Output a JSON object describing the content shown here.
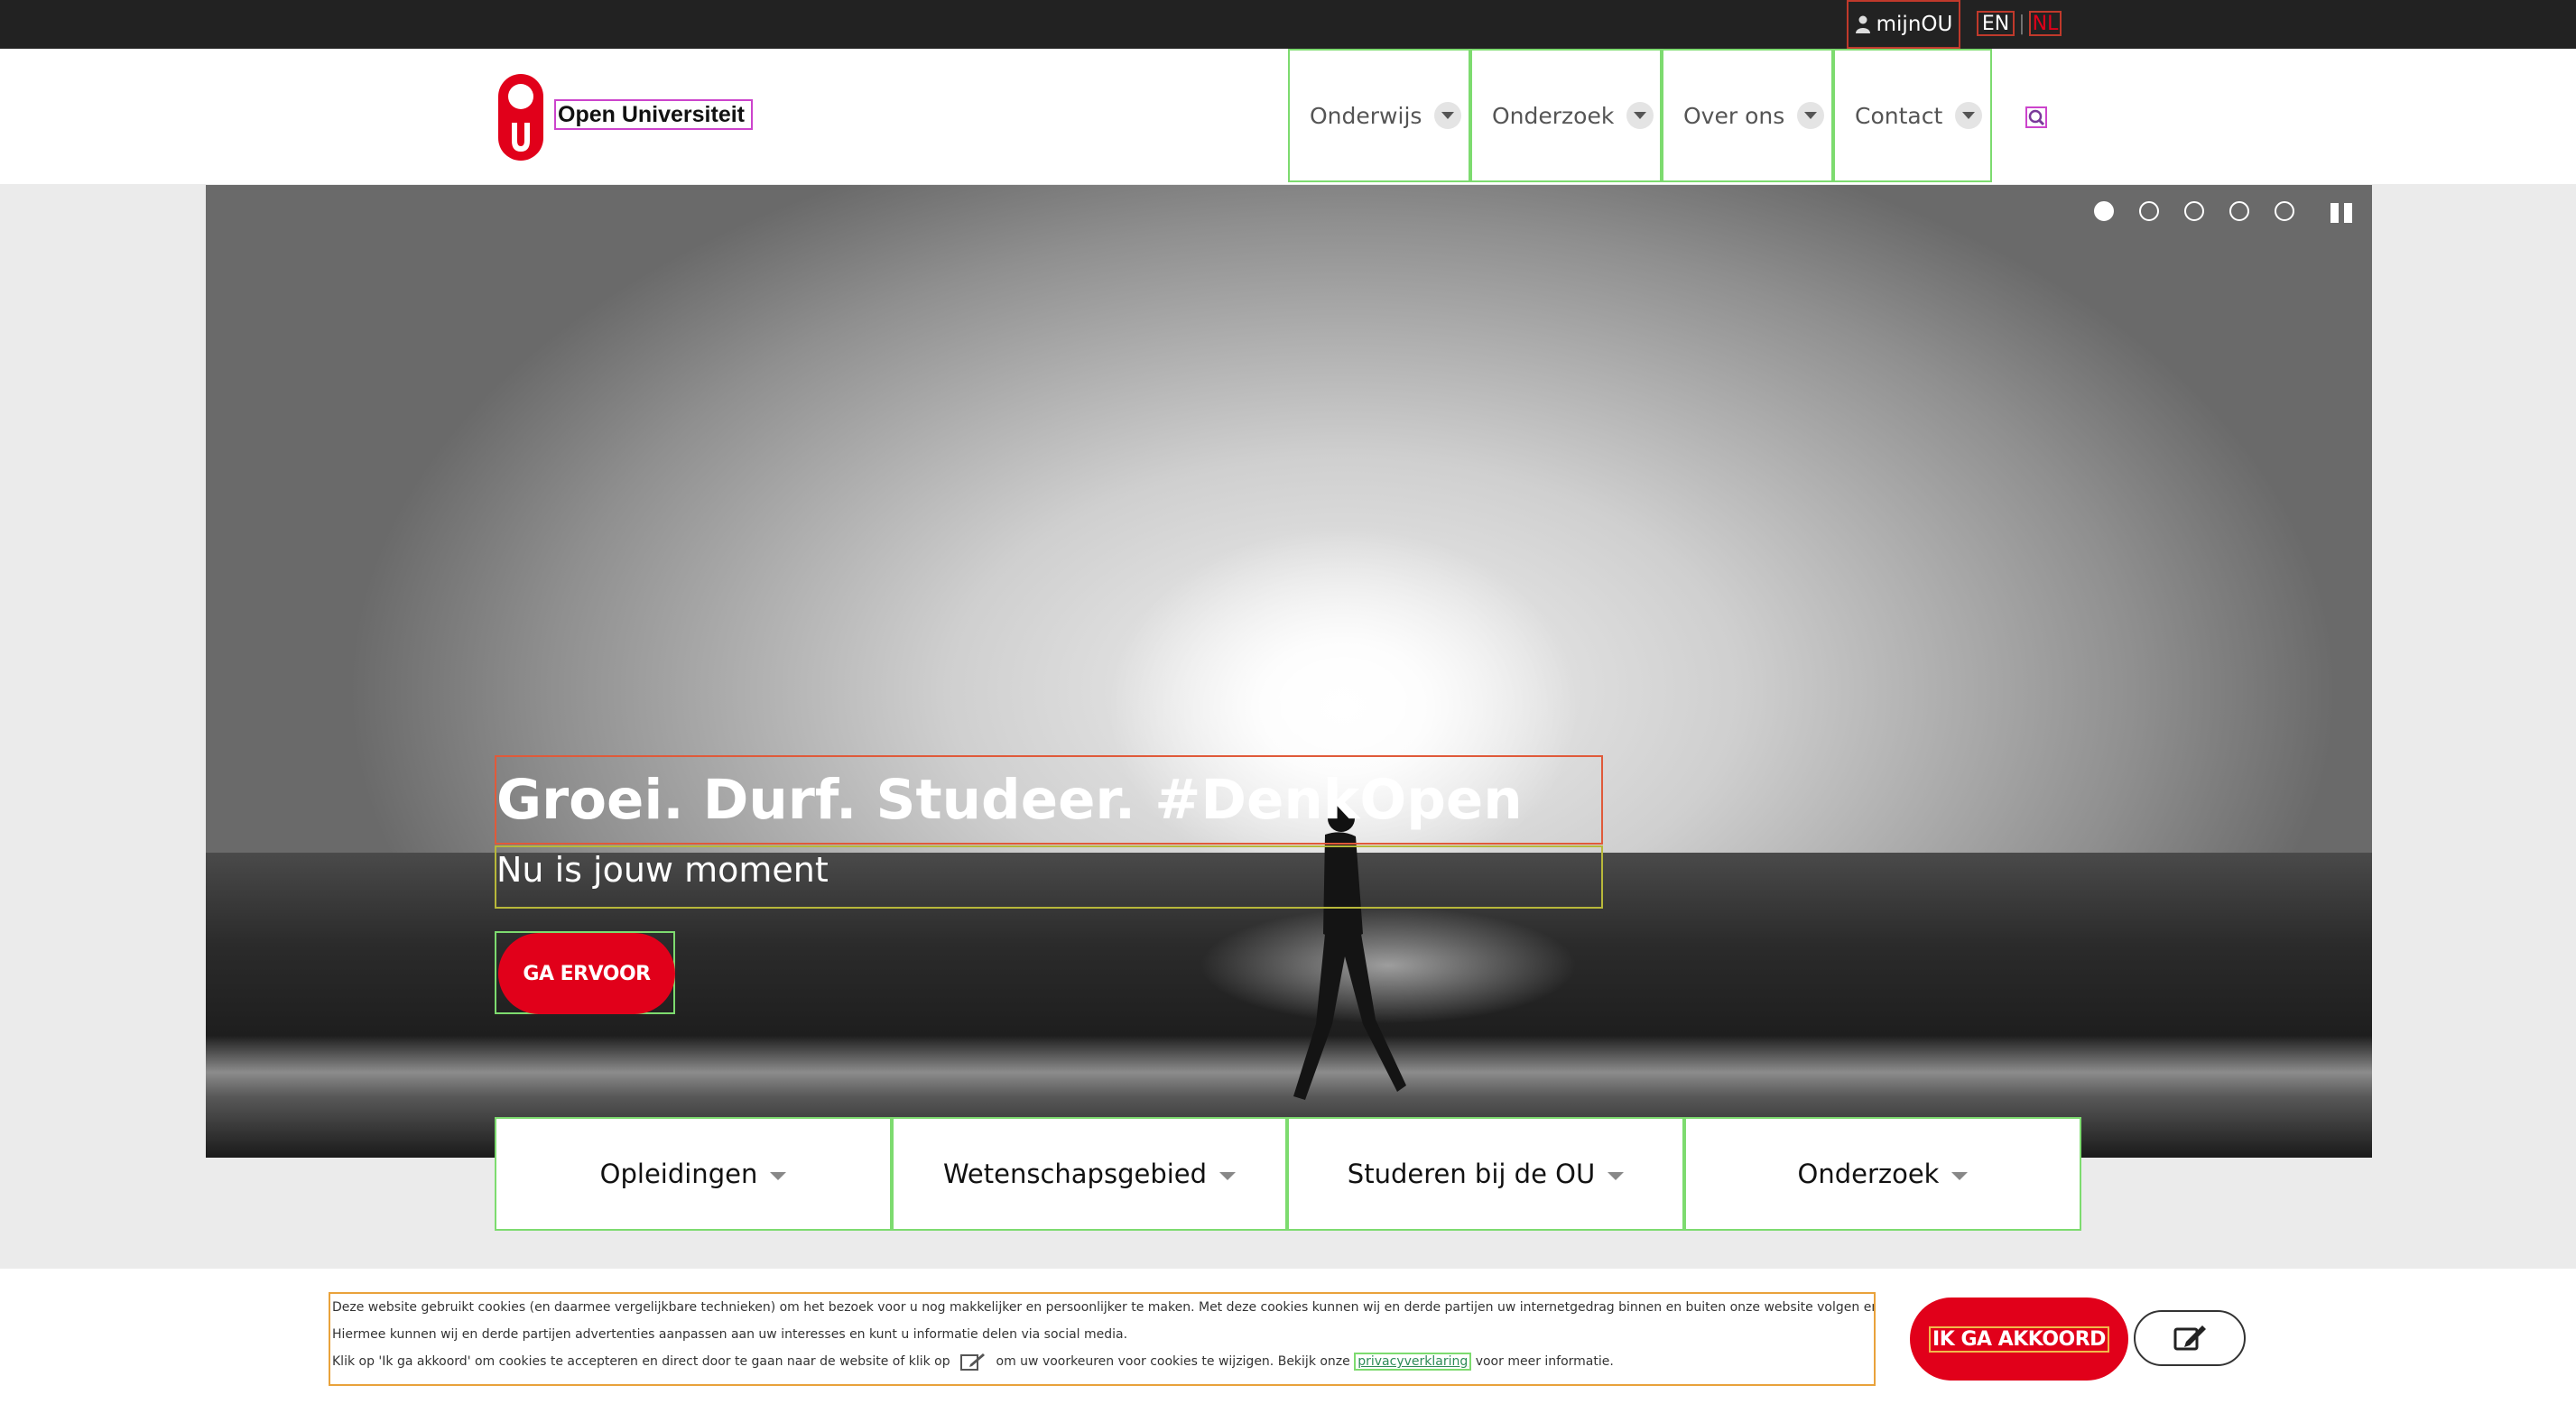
{
  "topbar": {
    "account_label": "mijnOU",
    "languages": [
      "EN",
      "NL"
    ],
    "language_separator": "|"
  },
  "header": {
    "brand_name": "Open Universiteit",
    "nav": [
      "Onderwijs",
      "Onderzoek",
      "Over ons",
      "Contact"
    ]
  },
  "hero": {
    "title": "Groei. Durf. Studeer. #DenkOpen",
    "subtitle": "Nu is jouw moment",
    "cta_label": "GA ERVOOR",
    "slide_count": 5,
    "active_slide": 1
  },
  "tabs": [
    "Opleidingen",
    "Wetenschapsgebied",
    "Studeren bij de OU",
    "Onderzoek"
  ],
  "cookie": {
    "line1": "Deze website gebruikt cookies (en daarmee vergelijkbare technieken) om het bezoek voor u nog makkelijker en persoonlijker te maken. Met deze cookies kunnen wij en derde partijen uw internetgedrag binnen en buiten onze website volgen en verzamelen.",
    "line2": "Hiermee kunnen wij en derde partijen advertenties aanpassen aan uw interesses en kunt u informatie delen via social media.",
    "line3_before": "Klik op 'Ik ga akkoord' om cookies te accepteren en direct door te gaan naar de website of klik op",
    "line3_middle": "om uw voorkeuren voor cookies te wijzigen. Bekijk onze",
    "privacy_link": "privacyverklaring",
    "line3_after": "voor meer informatie.",
    "agree_label": "IK GA AKKOORD"
  },
  "colors": {
    "brand_red": "#e1001a",
    "topbar": "#222222"
  }
}
